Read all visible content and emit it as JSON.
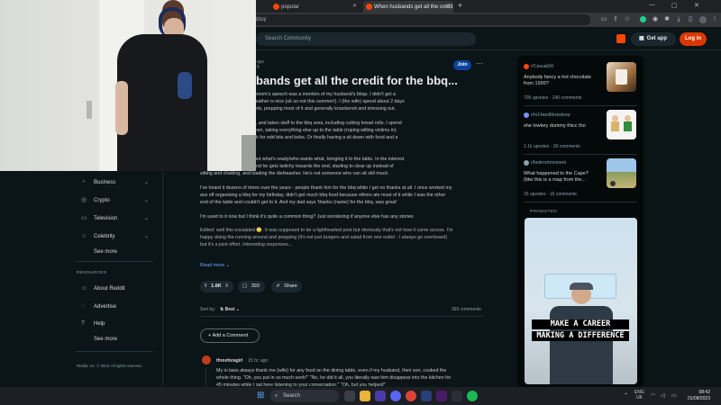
{
  "browser": {
    "tabs": [
      {
        "label": "popular"
      },
      {
        "label": "When husbands get all the credit"
      }
    ],
    "url_fragment": "bbq/",
    "new_tab": "+"
  },
  "header": {
    "search_placeholder": "Search Community",
    "get_app": "Get app",
    "login": "Log in"
  },
  "sidebar": {
    "topics": [
      {
        "label": "Business"
      },
      {
        "label": "Crypto"
      },
      {
        "label": "Television"
      },
      {
        "label": "Celebrity"
      }
    ],
    "see_more_1": "See more",
    "resources_heading": "RESOURCES",
    "resources": [
      {
        "label": "About Reddit"
      },
      {
        "label": "Advertise"
      },
      {
        "label": "Help"
      }
    ],
    "see_more_2": "See more",
    "footer": "Reddit, Inc. © 2023. All rights reserved."
  },
  "post": {
    "meta_line1": "ays",
    "meta_line2": "5",
    "join": "Join",
    "title": "bands get all the credit for the bbq...",
    "paragraphs": [
      "ng yesterday. Among the groom's speech was a mention of my husband's bbqs. I didn't get a\nregularly bbqs when the weather is nice (uk so not this summer!). I (the wife) spend about 2 days\nps, buying the food and drink, prepping most of it and generally knackered and stressing out.",
      "ts the meat from the fridge, and takes stuff to the bbq area, including cutting bread rolls. I spend\ng back and fore to the kitchen, taking everything else up to the table (roping willing victims in)\nthe mostest and going back for odd bits and bobs. Or finally having a sit down with food and a\nh our guests.",
      "sing the meat and calling out what's ready/who wants what, bringing it to the table. In the interest\nlown for most of the time and he gets twitchy towards the end, starting to clear up instead of\nsitting and chatting, and loading the dishwasher. He's not someone who can sit still much.",
      "I've heard it dozens of times over the years - people thank him for the bbq while I get no thanks at all. I once worked my\nass off organising a bbq for my birthday, didn't get much bbq food because others ate most of it while I was the other\nend of the table and couldn't get to it. And my dad says 'thanks (name) for the bbq, was great'",
      "I'm used to it now but I think it's quite a common thing? Just wondering if anyone else has any stories",
      "Edited: well this escalated 😳. It was supposed to be a lighthearted post but obviously that's not how it came across. I'm\nhappy doing the running around and prepping (it's not just burgers and salad from one outlet - I always go overboard)\nbut it's a joint effort. Interesting responses..."
    ],
    "read_more": "Read more",
    "upvotes": "1.6K",
    "comments_count": "393",
    "share": "Share",
    "sort_label": "Sort by:",
    "sort_value": "Best",
    "comments_total": "393 comments",
    "add_comment": "Add a Comment"
  },
  "comment": {
    "author": "threeforagirl",
    "age": "15 hr. ago",
    "text": "My in laws always thank me (wife) for any food on the dining table, even if my husband, their son, cooked the\nwhole thing. \"Oh, you put in so much work!\" \"No, he did it all, you literally saw him disappear into the kitchen for\n45 minutes while I sat here listening to your conversation.\" \"Oh, but you helped!\""
  },
  "right_column": {
    "items": [
      {
        "sub": "r/CasualUK",
        "title": "Anybody fancy a hot chocolate\nfrom 1999?",
        "meta": "705 upvotes  ·  140 comments"
      },
      {
        "sub": "r/m14andthisisdeep",
        "title": "she lowkey dummy thicc tho",
        "meta": "1.1k upvotes  ·  30 comments"
      },
      {
        "sub": "r/bedrockmoment",
        "title": "What happened to the Cape?\n(btw this is a map from the...",
        "meta": "15 upvotes  ·  15 comments"
      }
    ],
    "promoted_label": "PROMOTED",
    "ad_line1": "MAKE A CAREER",
    "ad_line2": "MAKING A DIFFERENCE"
  },
  "taskbar": {
    "search": "Search",
    "lang1": "ENG",
    "lang2": "UK",
    "time": "08:42",
    "date": "01/08/2023"
  },
  "colors": {
    "background": "#0b1416",
    "accent": "#ff4500",
    "login": "#d93900",
    "join": "#0a449b"
  }
}
